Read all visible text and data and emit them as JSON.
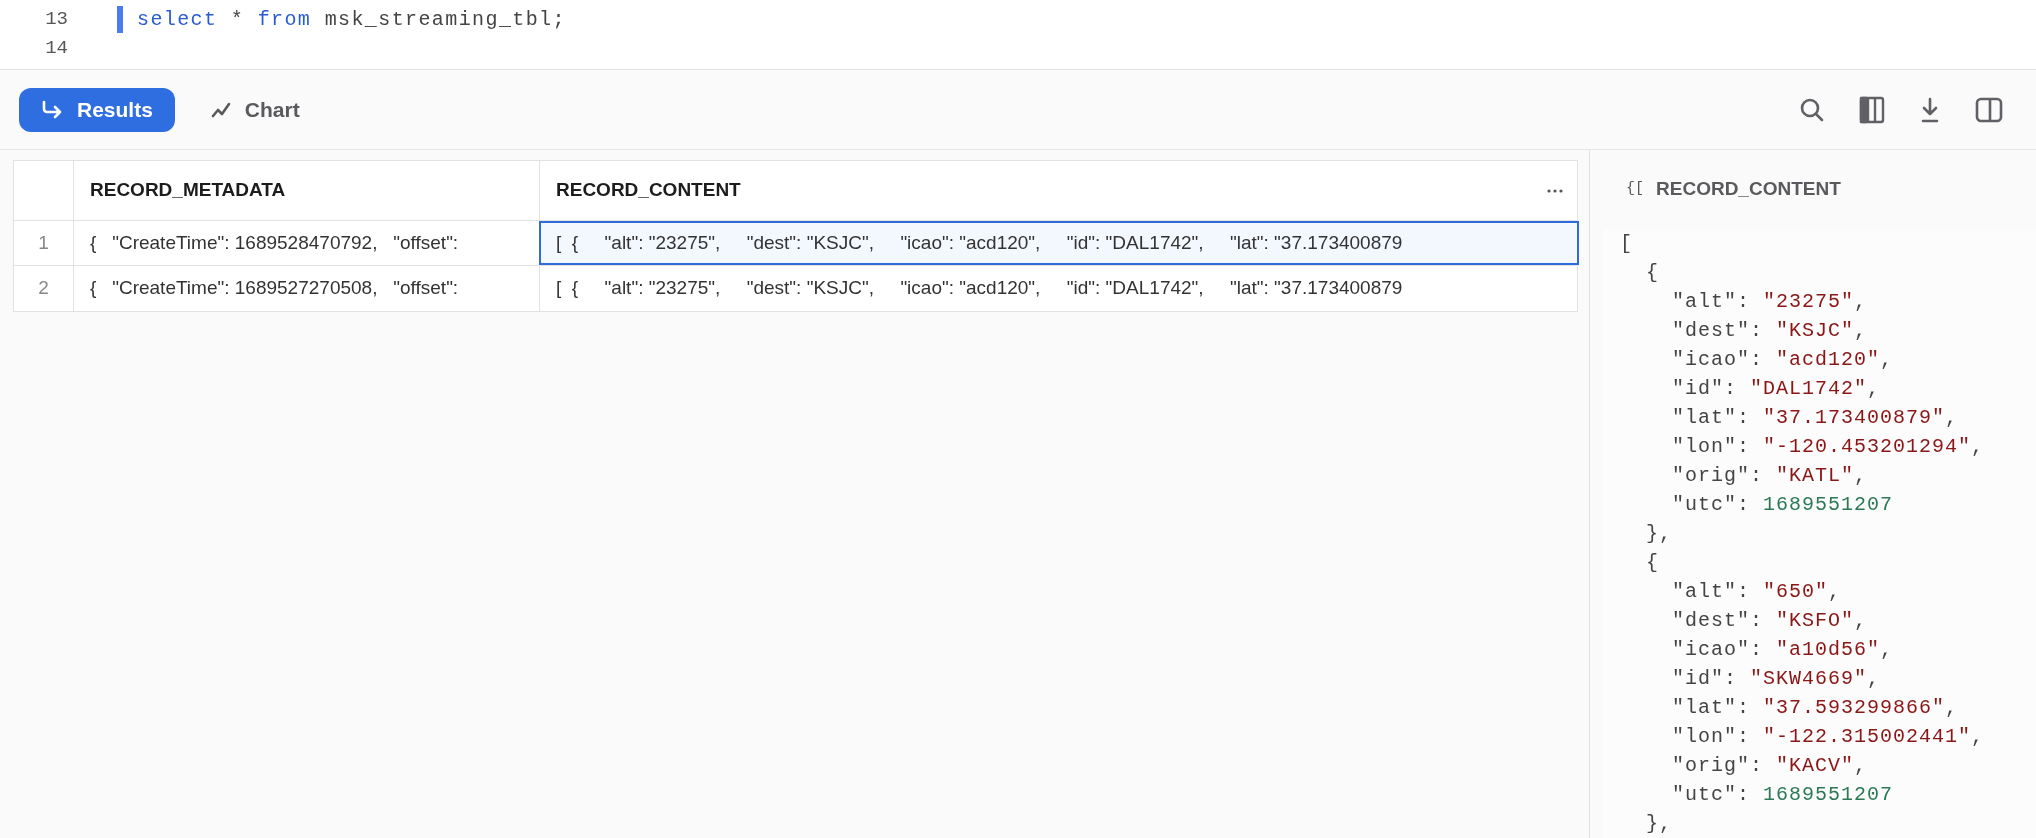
{
  "editor": {
    "lines": [
      {
        "number": "13",
        "active": true,
        "tokens": [
          {
            "text": "select",
            "kind": "keyword"
          },
          {
            "text": " * ",
            "kind": "plain"
          },
          {
            "text": "from",
            "kind": "keyword"
          },
          {
            "text": " msk_streaming_tbl;",
            "kind": "plain"
          }
        ]
      },
      {
        "number": "14",
        "active": false
      }
    ]
  },
  "result_tabs": [
    {
      "label": "Results",
      "selected": true
    },
    {
      "label": "Chart",
      "selected": false
    }
  ],
  "table": {
    "columns": [
      {
        "label": "RECORD_METADATA"
      },
      {
        "label": "RECORD_CONTENT"
      }
    ],
    "rows": [
      {
        "number": "1",
        "cells": [
          {
            "text": "{   \"CreateTime\": 1689528470792,   \"offset\":",
            "selected": false
          },
          {
            "text": "[  {     \"alt\": \"23275\",     \"dest\": \"KSJC\",     \"icao\": \"acd120\",     \"id\": \"DAL1742\",     \"lat\": \"37.173400879",
            "selected": true
          }
        ]
      },
      {
        "number": "2",
        "cells": [
          {
            "text": "{   \"CreateTime\": 1689527270508,   \"offset\":",
            "selected": false
          },
          {
            "text": "[  {     \"alt\": \"23275\",     \"dest\": \"KSJC\",     \"icao\": \"acd120\",     \"id\": \"DAL1742\",     \"lat\": \"37.173400879",
            "selected": false
          }
        ]
      }
    ]
  },
  "detail_panel": {
    "icon_text": "{[",
    "title": "RECORD_CONTENT",
    "json": {
      "open": "[",
      "children": [
        {
          "open": "{",
          "close": "},",
          "fields": [
            {
              "key": "\"alt\"",
              "colon": ":",
              "value": "\"23275\"",
              "comma": ",",
              "kind": "string"
            },
            {
              "key": "\"dest\"",
              "colon": ":",
              "value": "\"KSJC\"",
              "comma": ",",
              "kind": "string"
            },
            {
              "key": "\"icao\"",
              "colon": ":",
              "value": "\"acd120\"",
              "comma": ",",
              "kind": "string"
            },
            {
              "key": "\"id\"",
              "colon": ":",
              "value": "\"DAL1742\"",
              "comma": ",",
              "kind": "string"
            },
            {
              "key": "\"lat\"",
              "colon": ":",
              "value": "\"37.173400879\"",
              "comma": ",",
              "kind": "string"
            },
            {
              "key": "\"lon\"",
              "colon": ":",
              "value": "\"-120.453201294\"",
              "comma": ",",
              "kind": "string"
            },
            {
              "key": "\"orig\"",
              "colon": ":",
              "value": "\"KATL\"",
              "comma": ",",
              "kind": "string"
            },
            {
              "key": "\"utc\"",
              "colon": ":",
              "value": "1689551207",
              "kind": "number"
            }
          ]
        },
        {
          "open": "{",
          "close": "},",
          "fields": [
            {
              "key": "\"alt\"",
              "colon": ":",
              "value": "\"650\"",
              "comma": ",",
              "kind": "string"
            },
            {
              "key": "\"dest\"",
              "colon": ":",
              "value": "\"KSFO\"",
              "comma": ",",
              "kind": "string"
            },
            {
              "key": "\"icao\"",
              "colon": ":",
              "value": "\"a10d56\"",
              "comma": ",",
              "kind": "string"
            },
            {
              "key": "\"id\"",
              "colon": ":",
              "value": "\"SKW4669\"",
              "comma": ",",
              "kind": "string"
            },
            {
              "key": "\"lat\"",
              "colon": ":",
              "value": "\"37.593299866\"",
              "comma": ",",
              "kind": "string"
            },
            {
              "key": "\"lon\"",
              "colon": ":",
              "value": "\"-122.315002441\"",
              "comma": ",",
              "kind": "string"
            },
            {
              "key": "\"orig\"",
              "colon": ":",
              "value": "\"KACV\"",
              "comma": ",",
              "kind": "string"
            },
            {
              "key": "\"utc\"",
              "colon": ":",
              "value": "1689551207",
              "kind": "number"
            }
          ]
        }
      ]
    }
  }
}
